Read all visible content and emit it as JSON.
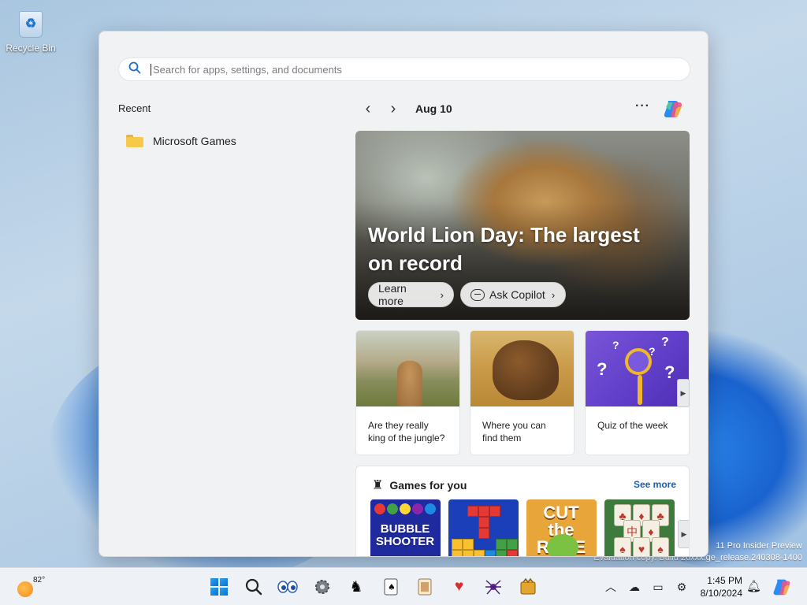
{
  "desktop": {
    "recycle_bin_label": "Recycle Bin",
    "watermark_line1": "11 Pro Insider Preview",
    "watermark_line2": "Evaluation copy. Build 26xxx.ge_release.240308-1400"
  },
  "search": {
    "placeholder": "Search for apps, settings, and documents"
  },
  "recent": {
    "title": "Recent",
    "items": [
      {
        "label": "Microsoft Games",
        "icon": "folder-icon"
      }
    ]
  },
  "highlights": {
    "date": "Aug 10",
    "more_label": "···",
    "hero": {
      "headline": "World Lion Day: The largest on record",
      "learn_more": "Learn more",
      "ask_copilot": "Ask Copilot"
    },
    "cards": [
      {
        "caption": "Are they really king of the jungle?"
      },
      {
        "caption": "Where you can find them"
      },
      {
        "caption": "Quiz of the week"
      }
    ]
  },
  "games": {
    "title": "Games for you",
    "see_more": "See more",
    "tiles": [
      {
        "title": "BUBBLE SHOOTER"
      },
      {
        "title": ""
      },
      {
        "title": "CUT the ROPE"
      },
      {
        "title": ""
      }
    ]
  },
  "taskbar": {
    "weather_temp": "82°",
    "apps": [
      "start-icon",
      "search-icon",
      "eyes-app-icon",
      "gear-app-icon",
      "chess-app-icon",
      "solitaire-app-icon",
      "cards-app-icon",
      "hearts-app-icon",
      "spider-app-icon",
      "freecell-app-icon"
    ],
    "clock_time": "1:45 PM",
    "clock_date": "8/10/2024"
  },
  "colors": {
    "accent": "#1b5fb4",
    "panel_bg": "#f1f2f4",
    "taskbar_bg": "#eef1f5"
  }
}
